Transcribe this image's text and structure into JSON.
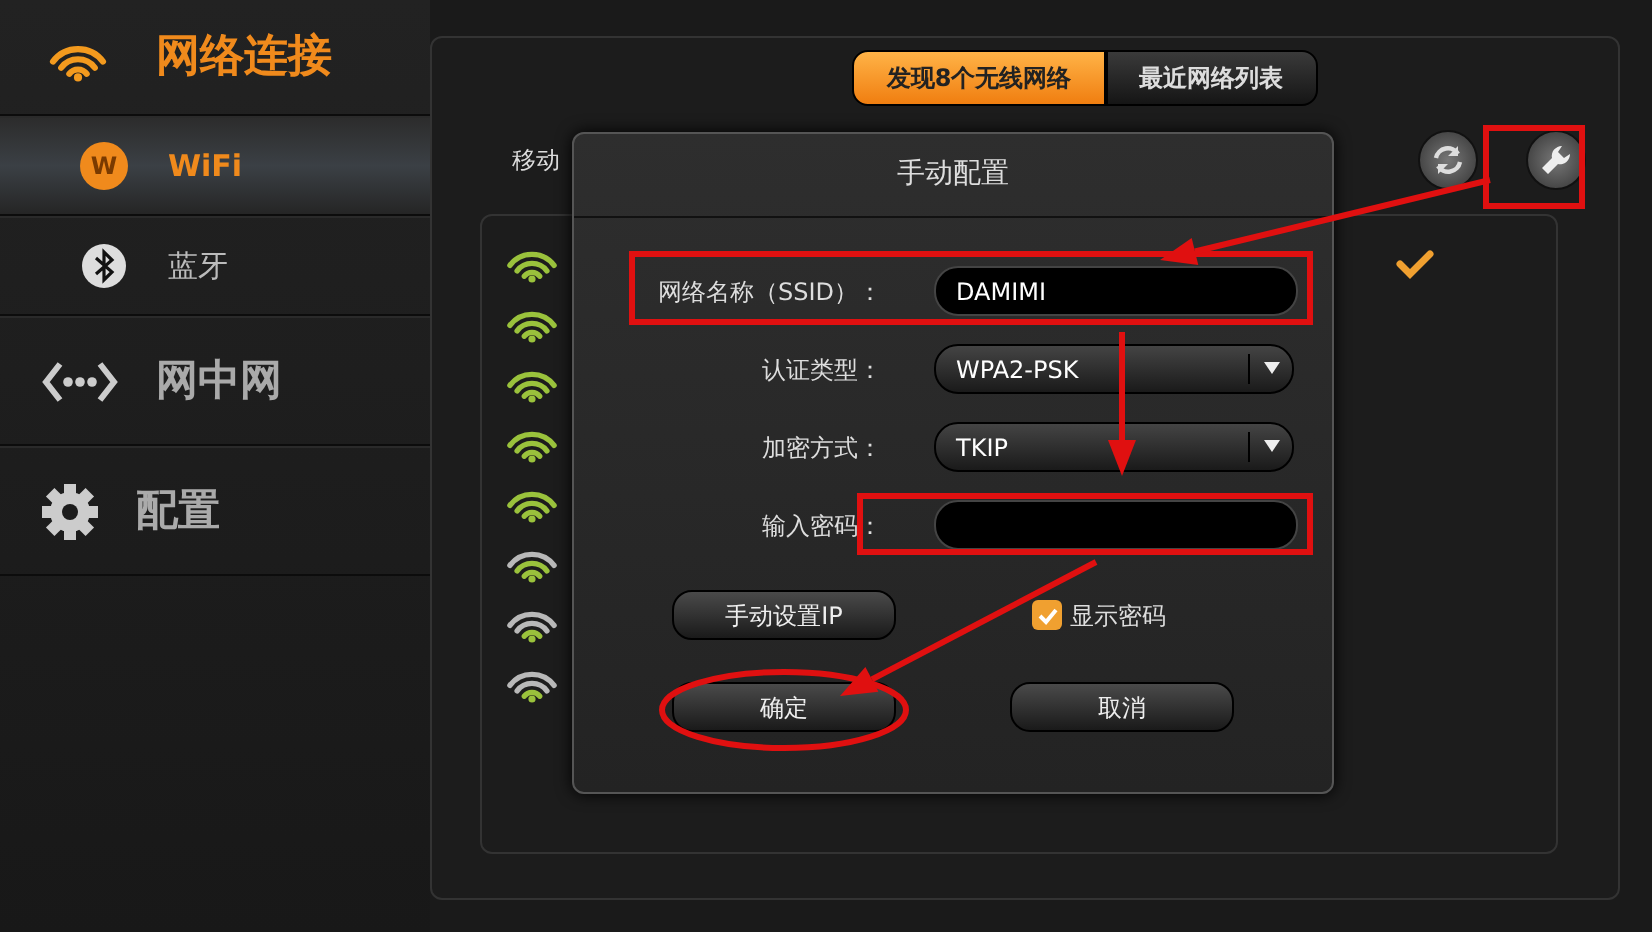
{
  "sidebar": {
    "title": "网络连接",
    "items": [
      {
        "label": "WiFi",
        "selected": true,
        "kind": "sub",
        "badge_text": "W"
      },
      {
        "label": "蓝牙",
        "selected": false,
        "kind": "sub"
      },
      {
        "label": "网中网",
        "selected": false,
        "kind": "main"
      },
      {
        "label": "配置",
        "selected": false,
        "kind": "main"
      }
    ]
  },
  "tabs": [
    {
      "label": "发现8个无线网络",
      "selected": true
    },
    {
      "label": "最近网络列表",
      "selected": false
    }
  ],
  "section_label": "移动",
  "networks": [
    {
      "kind": "full",
      "connected": true
    },
    {
      "kind": "full",
      "connected": false
    },
    {
      "kind": "full",
      "connected": false
    },
    {
      "kind": "full",
      "connected": false
    },
    {
      "kind": "full",
      "connected": false
    },
    {
      "kind": "three",
      "connected": false
    },
    {
      "kind": "two",
      "connected": false
    },
    {
      "kind": "two",
      "connected": false
    }
  ],
  "dialog": {
    "title": "手动配置",
    "fields": [
      {
        "label": "网络名称（SSID）：",
        "kind": "text",
        "value": "DAMIMI"
      },
      {
        "label": "认证类型：",
        "kind": "select",
        "value": "WPA2-PSK"
      },
      {
        "label": "加密方式：",
        "kind": "select",
        "value": "TKIP"
      },
      {
        "label": "输入密码：",
        "kind": "password"
      }
    ],
    "manual_ip_button": "手动设置IP",
    "show_password": {
      "label": "显示密码",
      "checked": true
    },
    "buttons": [
      "确定",
      "取消"
    ]
  }
}
